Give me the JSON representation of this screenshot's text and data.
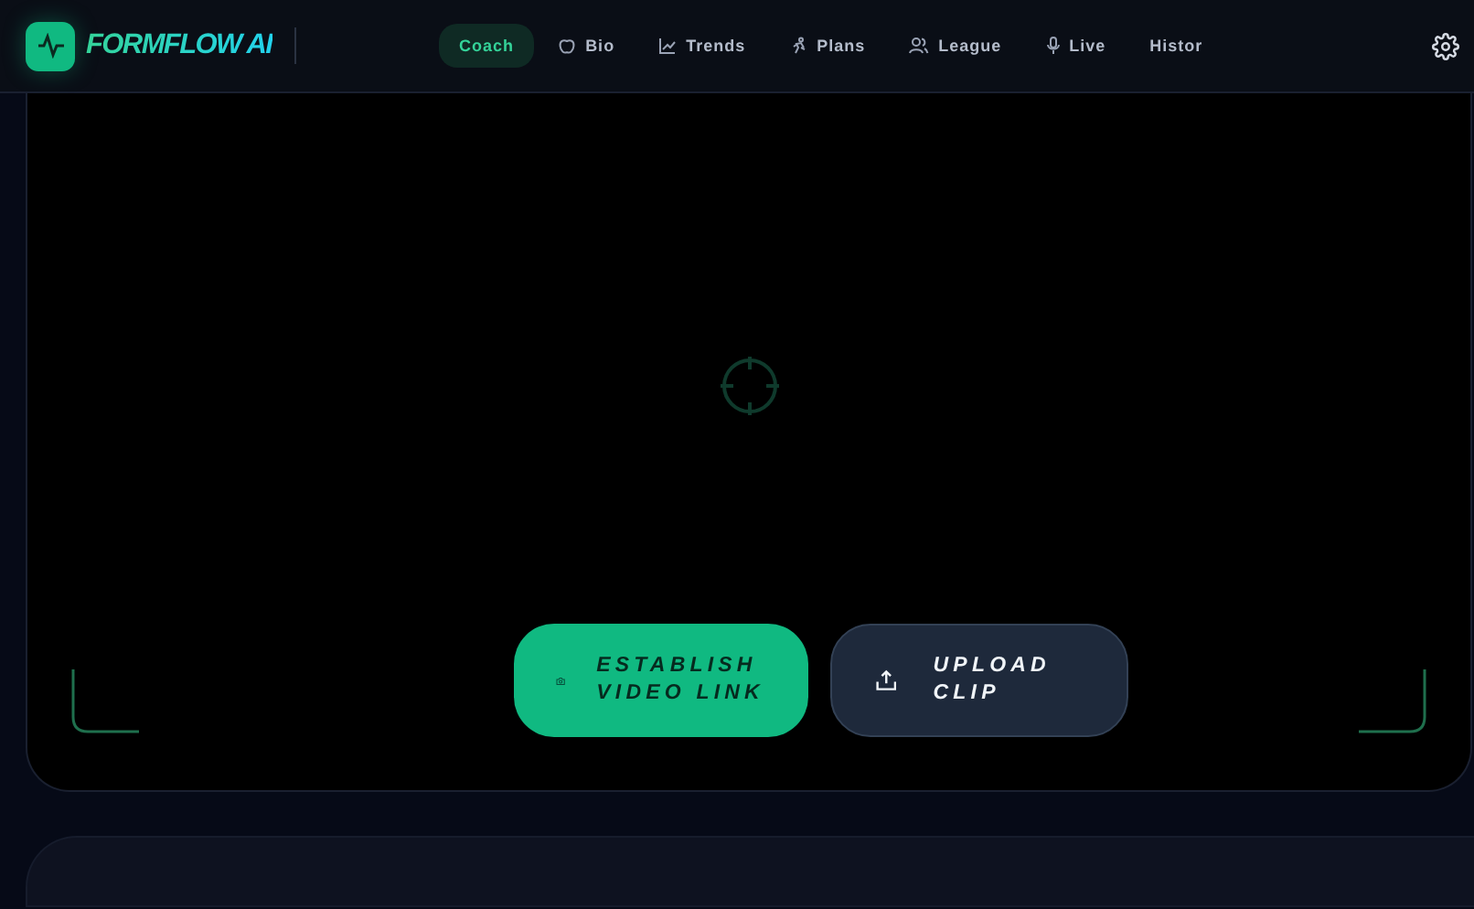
{
  "brand": {
    "name": "FORMFLOW AI"
  },
  "nav": [
    {
      "label": "Coach",
      "kind": "plain",
      "selected": true
    },
    {
      "label": "Bio",
      "kind": "apple",
      "selected": false
    },
    {
      "label": "Trends",
      "kind": "chart",
      "selected": false
    },
    {
      "label": "Plans",
      "kind": "runner",
      "selected": false
    },
    {
      "label": "League",
      "kind": "users",
      "selected": false
    },
    {
      "label": "Live",
      "kind": "mic",
      "selected": false
    },
    {
      "label": "Histor",
      "kind": "plain",
      "selected": false
    }
  ],
  "viewer": {
    "buttons": [
      {
        "label": "ESTABLISH VIDEO LINK",
        "kind": "primary"
      },
      {
        "label": "UPLOAD CLIP",
        "kind": "secondary"
      }
    ]
  }
}
